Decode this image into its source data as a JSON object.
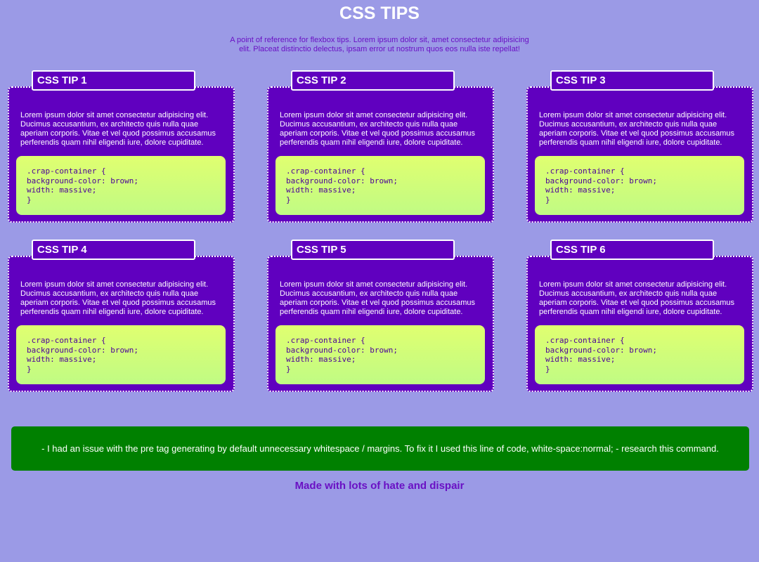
{
  "header": {
    "title": "CSS TIPS",
    "intro": "A point of reference for flexbox tips. Lorem ipsum dolor sit, amet consectetur adipisicing elit. Placeat distinctio delectus, ipsam error ut nostrum quos eos nulla iste repellat!"
  },
  "tips": [
    {
      "title": "CSS TIP 1",
      "text": "Lorem ipsum dolor sit amet consectetur adipisicing elit. Ducimus accusantium, ex architecto quis nulla quae aperiam corporis. Vitae et vel quod possimus accusamus perferendis quam nihil eligendi iure, dolore cupiditate.",
      "code": [
        ".crap-container {",
        "background-color: brown;",
        "width: massive;",
        "}"
      ]
    },
    {
      "title": "CSS TIP 2",
      "text": "Lorem ipsum dolor sit amet consectetur adipisicing elit. Ducimus accusantium, ex architecto quis nulla quae aperiam corporis. Vitae et vel quod possimus accusamus perferendis quam nihil eligendi iure, dolore cupiditate.",
      "code": [
        ".crap-container {",
        "background-color: brown;",
        "width: massive;",
        "}"
      ]
    },
    {
      "title": "CSS TIP 3",
      "text": "Lorem ipsum dolor sit amet consectetur adipisicing elit. Ducimus accusantium, ex architecto quis nulla quae aperiam corporis. Vitae et vel quod possimus accusamus perferendis quam nihil eligendi iure, dolore cupiditate.",
      "code": [
        ".crap-container {",
        "background-color: brown;",
        "width: massive;",
        "}"
      ]
    },
    {
      "title": "CSS TIP 4",
      "text": "Lorem ipsum dolor sit amet consectetur adipisicing elit. Ducimus accusantium, ex architecto quis nulla quae aperiam corporis. Vitae et vel quod possimus accusamus perferendis quam nihil eligendi iure, dolore cupiditate.",
      "code": [
        ".crap-container {",
        "background-color: brown;",
        "width: massive;",
        "}"
      ]
    },
    {
      "title": "CSS TIP 5",
      "text": "Lorem ipsum dolor sit amet consectetur adipisicing elit. Ducimus accusantium, ex architecto quis nulla quae aperiam corporis. Vitae et vel quod possimus accusamus perferendis quam nihil eligendi iure, dolore cupiditate.",
      "code": [
        ".crap-container {",
        "background-color: brown;",
        "width: massive;",
        "}"
      ]
    },
    {
      "title": "CSS TIP 6",
      "text": "Lorem ipsum dolor sit amet consectetur adipisicing elit. Ducimus accusantium, ex architecto quis nulla quae aperiam corporis. Vitae et vel quod possimus accusamus perferendis quam nihil eligendi iure, dolore cupiditate.",
      "code": [
        ".crap-container {",
        "background-color: brown;",
        "width: massive;",
        "}"
      ]
    }
  ],
  "note": "- I had an issue with the pre tag generating by default unnecessary whitespace / margins. To fix it I used this line of code, white-space:normal; - research this command.",
  "footer": "Made with lots of hate and dispair",
  "colors": {
    "page_background": "#9b9ae6",
    "card_purple": "#6000bf",
    "code_gradient_top": "#e0ff70",
    "code_gradient_bottom": "#c0fb84",
    "note_green": "#008000",
    "accent_text": "#6a10c4"
  }
}
